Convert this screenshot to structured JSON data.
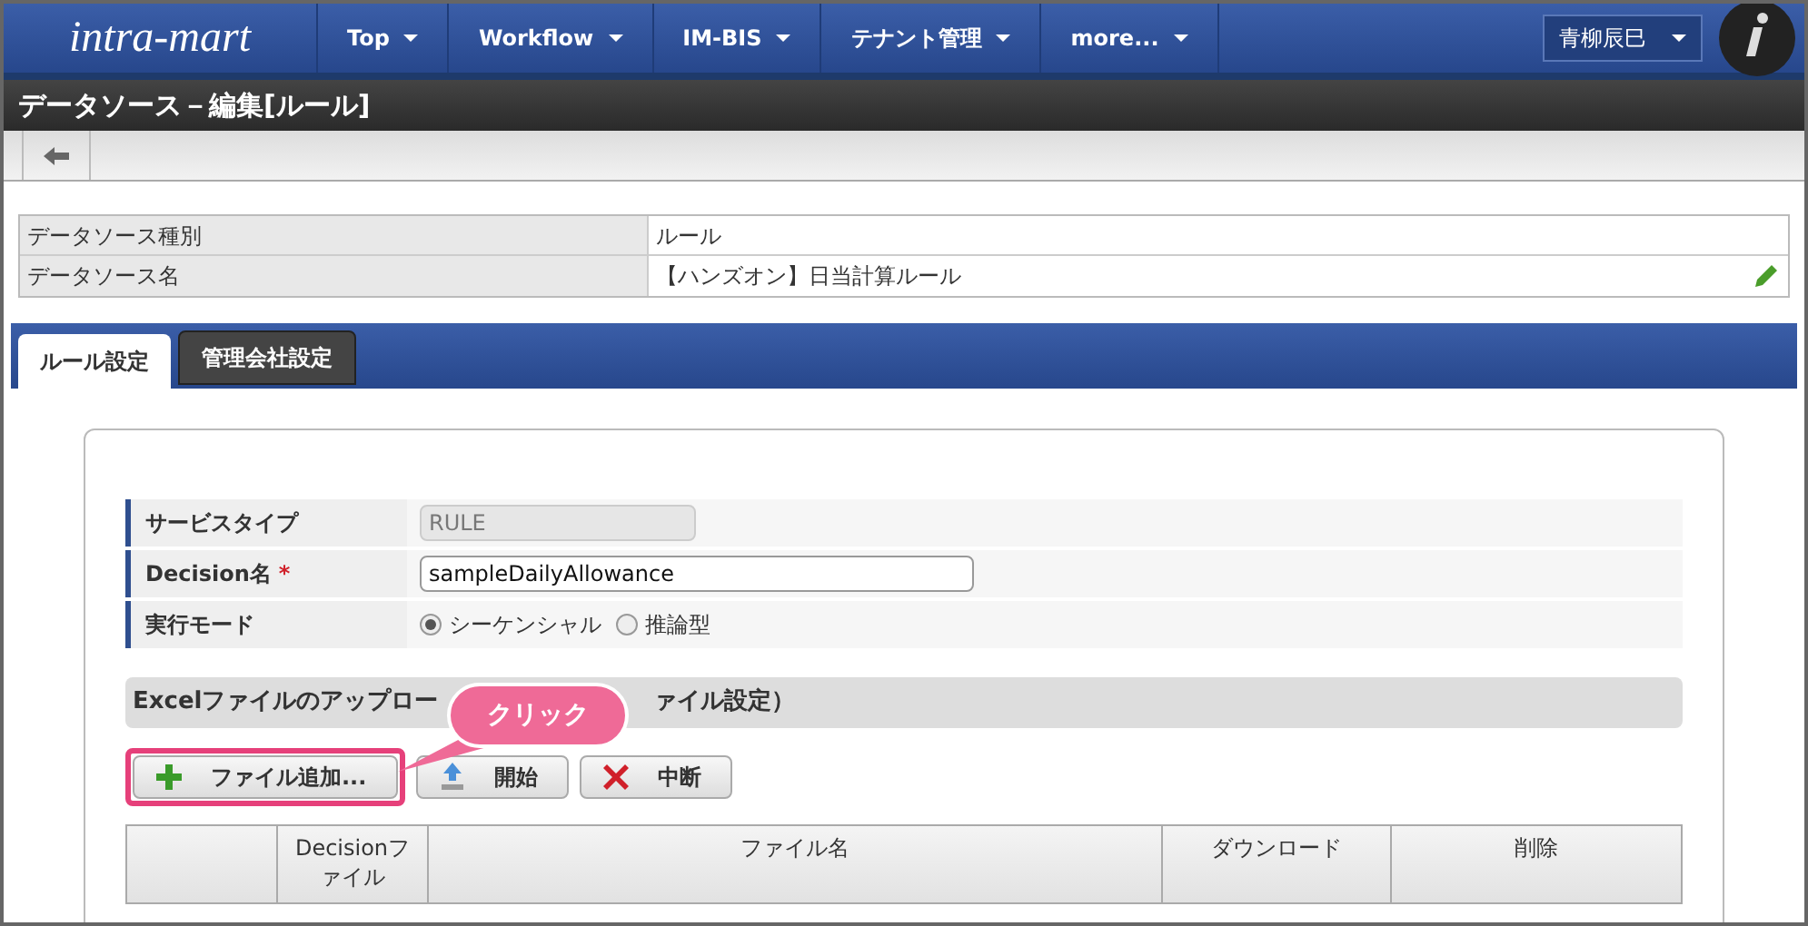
{
  "nav": {
    "logo": "intra-mart",
    "menus": [
      "Top",
      "Workflow",
      "IM-BIS",
      "テナント管理",
      "more..."
    ],
    "user": "青柳辰巳"
  },
  "title": "データソース－編集[ルール]",
  "info": [
    {
      "label": "データソース種別",
      "value": "ルール",
      "editable": false
    },
    {
      "label": "データソース名",
      "value": "【ハンズオン】日当計算ルール",
      "editable": true
    }
  ],
  "tabs": [
    {
      "label": "ルール設定",
      "selected": true
    },
    {
      "label": "管理会社設定",
      "selected": false
    }
  ],
  "form": [
    {
      "kind": "readonly",
      "label": "サービスタイプ",
      "value": "RULE"
    },
    {
      "kind": "input",
      "label": "Decision名",
      "required_mark": "*",
      "value": "sampleDailyAllowance"
    },
    {
      "kind": "radio",
      "label": "実行モード",
      "options": [
        {
          "label": "シーケンシャル",
          "selected": true
        },
        {
          "label": "推論型",
          "selected": false
        }
      ]
    }
  ],
  "section": {
    "heading_left": "Excelファイルのアップロー",
    "heading_right": "ァイル設定）"
  },
  "buttons": [
    {
      "kind": "add",
      "label": "ファイル追加...",
      "highlighted": true
    },
    {
      "kind": "upload",
      "label": "開始",
      "highlighted": false
    },
    {
      "kind": "cancel",
      "label": "中断",
      "highlighted": false
    }
  ],
  "callout": "クリック",
  "table": {
    "columns": [
      "Decisionファイル",
      "ファイル名",
      "ダウンロード",
      "削除"
    ]
  }
}
